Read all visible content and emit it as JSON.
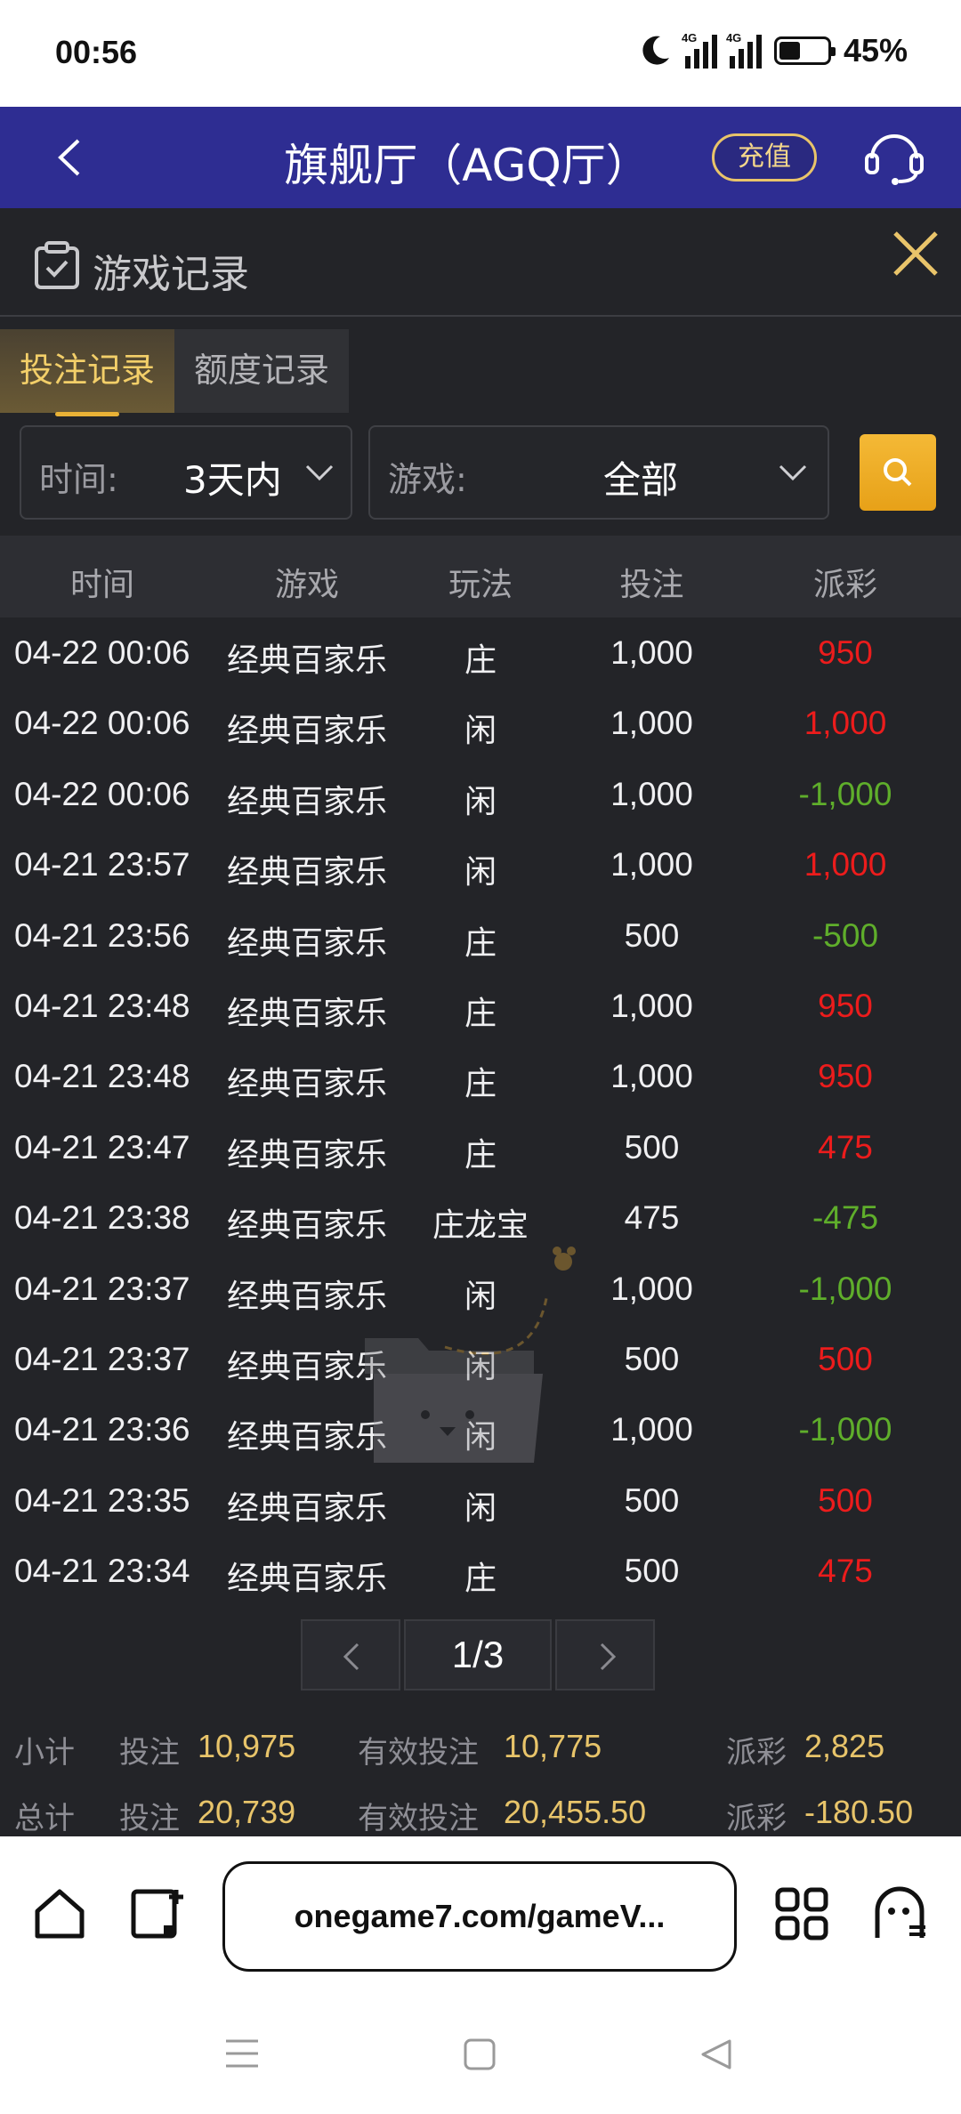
{
  "status_bar": {
    "time": "00:56",
    "network1": "4G",
    "network2": "4G",
    "battery": "45%",
    "battery_level": 0.45
  },
  "header": {
    "title": "旗舰厅（AGQ厅）",
    "recharge_label": "充值",
    "icons": [
      "back-arrow-icon",
      "customer-service-headset-icon"
    ],
    "colors": {
      "background": "#2e2d92",
      "accent": "#e9c46a"
    }
  },
  "panel": {
    "title": "游戏记录",
    "icons": [
      "clipboard-check-icon",
      "close-icon"
    ],
    "tabs": [
      {
        "label": "投注记录",
        "active": true
      },
      {
        "label": "额度记录",
        "active": false
      }
    ]
  },
  "filters": {
    "time_label": "时间:",
    "time_value": "3天内",
    "game_label": "游戏:",
    "game_value": "全部",
    "search_icon": "search-icon"
  },
  "table": {
    "headers": [
      "时间",
      "游戏",
      "玩法",
      "投注",
      "派彩"
    ],
    "rows": [
      [
        "04-22 00:06",
        "经典百家乐",
        "庄",
        "1,000",
        "950"
      ],
      [
        "04-22 00:06",
        "经典百家乐",
        "闲",
        "1,000",
        "1,000"
      ],
      [
        "04-22 00:06",
        "经典百家乐",
        "闲",
        "1,000",
        "-1,000"
      ],
      [
        "04-21 23:57",
        "经典百家乐",
        "闲",
        "1,000",
        "1,000"
      ],
      [
        "04-21 23:56",
        "经典百家乐",
        "庄",
        "500",
        "-500"
      ],
      [
        "04-21 23:48",
        "经典百家乐",
        "庄",
        "1,000",
        "950"
      ],
      [
        "04-21 23:48",
        "经典百家乐",
        "庄",
        "1,000",
        "950"
      ],
      [
        "04-21 23:47",
        "经典百家乐",
        "庄",
        "500",
        "475"
      ],
      [
        "04-21 23:38",
        "经典百家乐",
        "庄龙宝",
        "475",
        "-475"
      ],
      [
        "04-21 23:37",
        "经典百家乐",
        "闲",
        "1,000",
        "-1,000"
      ],
      [
        "04-21 23:37",
        "经典百家乐",
        "闲",
        "500",
        "500"
      ],
      [
        "04-21 23:36",
        "经典百家乐",
        "闲",
        "1,000",
        "-1,000"
      ],
      [
        "04-21 23:35",
        "经典百家乐",
        "闲",
        "500",
        "500"
      ],
      [
        "04-21 23:34",
        "经典百家乐",
        "庄",
        "500",
        "475"
      ]
    ],
    "colors": {
      "positive": "#ec1c1c",
      "negative": "#5fae2b"
    }
  },
  "pagination": {
    "page": "1/3"
  },
  "summary": {
    "subtotal": {
      "label": "小计",
      "bet_label": "投注",
      "bet": "10,975",
      "valid_label": "有效投注",
      "valid": "10,775",
      "payout_label": "派彩",
      "payout": "2,825"
    },
    "total": {
      "label": "总计",
      "bet_label": "投注",
      "bet": "20,739",
      "valid_label": "有效投注",
      "valid": "20,455.50",
      "payout_label": "派彩",
      "payout": "-180.50"
    }
  },
  "browser": {
    "url": "onegame7.com/gameV...",
    "icons": [
      "home-icon",
      "tab-switch-icon",
      "apps-grid-icon",
      "ghost-incognito-icon"
    ]
  },
  "nav_bar": {
    "icons": [
      "menu-icon",
      "home-square-icon",
      "back-triangle-icon"
    ]
  }
}
